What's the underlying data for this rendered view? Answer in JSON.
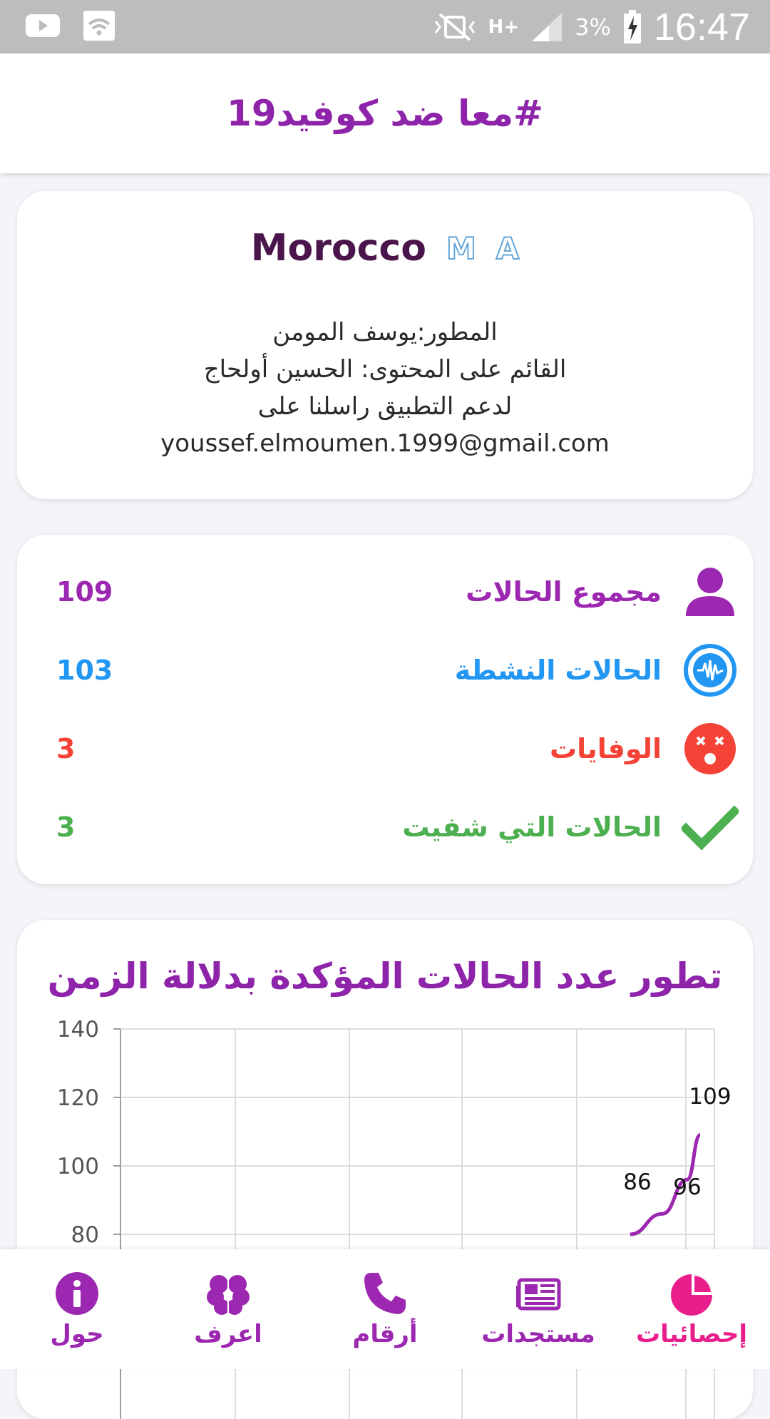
{
  "status_bar": {
    "network": "H+",
    "battery": "3%",
    "time": "16:47"
  },
  "app_bar": {
    "title": "#معا ضد كوفيد19"
  },
  "info_card": {
    "country": "Morocco",
    "country_code": [
      "M",
      "A"
    ],
    "lines": [
      "المطور:يوسف المومن",
      "القائم على المحتوى: الحسين أولحاج",
      "لدعم التطبيق راسلنا على",
      "youssef.elmoumen.1999@gmail.com"
    ]
  },
  "stats": [
    {
      "label": "مجموع الحالات",
      "value": "109",
      "color": "#9c27b0",
      "icon": "person-icon"
    },
    {
      "label": "الحالات  النشطة",
      "value": "103",
      "color": "#2196f3",
      "icon": "virus-icon"
    },
    {
      "label": "الوفايات",
      "value": "3",
      "color": "#f44336",
      "icon": "dead-face-icon"
    },
    {
      "label": "الحالات التي شفيت",
      "value": "3",
      "color": "#4caf50",
      "icon": "check-icon"
    }
  ],
  "chart_data": {
    "type": "line",
    "title": "تطور عدد الحالات المؤكدة بدلالة الزمن",
    "ylim": [
      80,
      140
    ],
    "yticks": [
      140,
      120,
      100,
      80
    ],
    "grid": true,
    "series": [
      {
        "values": [
          80,
          86,
          96,
          109
        ],
        "color": "#9c27b0"
      }
    ],
    "data_labels": [
      {
        "text": "86",
        "value": 86
      },
      {
        "text": "96",
        "value": 96
      },
      {
        "text": "109",
        "value": 109
      }
    ]
  },
  "bottom_nav": [
    {
      "label": "حول",
      "icon": "info-icon",
      "color": "#9c27b0",
      "active": false
    },
    {
      "label": "اعرف",
      "icon": "brain-icon",
      "color": "#9c27b0",
      "active": false
    },
    {
      "label": "أرقام",
      "icon": "phone-icon",
      "color": "#9c27b0",
      "active": false
    },
    {
      "label": "مستجدات",
      "icon": "newspaper-icon",
      "color": "#9c27b0",
      "active": false
    },
    {
      "label": "إحصائيات",
      "icon": "pie-chart-icon",
      "color": "#e91e8c",
      "active": true
    }
  ]
}
